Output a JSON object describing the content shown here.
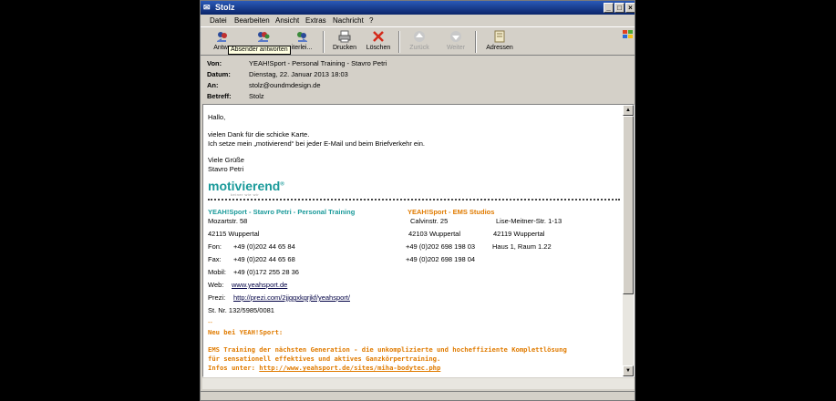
{
  "window": {
    "title": "Stolz"
  },
  "menu": [
    "Datei",
    "Bearbeiten",
    "Ansicht",
    "Extras",
    "Nachricht",
    "?"
  ],
  "toolbar": [
    {
      "label": "Antwo",
      "icon": "reply-icon",
      "disabled": false
    },
    {
      "label": "",
      "icon": "reply-all-icon",
      "disabled": false
    },
    {
      "label": "iterlei...",
      "icon": "forward-icon",
      "disabled": false
    },
    {
      "label": "Drucken",
      "icon": "print-icon",
      "disabled": false
    },
    {
      "label": "Löschen",
      "icon": "delete-icon",
      "disabled": false
    },
    {
      "label": "Zurück",
      "icon": "back-icon",
      "disabled": true
    },
    {
      "label": "Weiter",
      "icon": "next-icon",
      "disabled": true
    },
    {
      "label": "Adressen",
      "icon": "address-book-icon",
      "disabled": false
    }
  ],
  "tooltip": "Absender antworten",
  "headers": [
    {
      "key": "Von:",
      "value": "YEAH!Sport  -  Personal Training - Stavro Petri"
    },
    {
      "key": "Datum:",
      "value": "Dienstag, 22. Januar 2013 18:03"
    },
    {
      "key": "An:",
      "value": "stolz@oundmdesign.de"
    },
    {
      "key": "Betreff:",
      "value": "Stolz"
    }
  ],
  "message": {
    "greeting": "Hallo,",
    "line1": "vielen Dank für die schicke Karte.",
    "line2": "Ich setze mein „motivierend“ bei jeder E-Mail und beim Briefverkehr ein.",
    "closing": "Viele Grüße",
    "signature_name": "Stavro Petri",
    "logo": "motivierend",
    "logo_reg": "®",
    "logo_sub": "keiner wie wir",
    "left_title": "YEAH!Sport - Stavro Petri - Personal Training",
    "left_street": "Mozartstr. 58",
    "left_city": "42115 Wuppertal",
    "fon_label": "Fon:",
    "fon": "+49 (0)202 44 65 84",
    "fax_label": "Fax:",
    "fax": "+49 (0)202 44 65 68",
    "mobil_label": "Mobil:",
    "mobil": "+49 (0)172 255 28 36",
    "web_label": "Web:",
    "web": "www.yeahsport.de",
    "prezi_label": "Prezi:",
    "prezi": "http://prezi.com/2jjggxkgrjkf/yeahsport/",
    "stnr": "St. Nr. 132/5985/0081",
    "right_title": "YEAH!Sport - EMS Studios",
    "r_street1": "Calvinstr. 25",
    "r_street2": "Lise-Meitner-Str. 1-13",
    "r_city1": "42103 Wuppertal",
    "r_city2": "42119 Wuppertal",
    "r_phone1": "+49 (0)202 698 198 03",
    "r_phone1_extra": "Haus 1, Raum 1.22",
    "r_phone2": "+49 (0)202 698 198 04",
    "dashes": "--",
    "news_title": "Neu bei YEAH!Sport:",
    "news1": "EMS Training der nächsten Generation - die unkomplizierte und hocheffiziente Komplettlösung",
    "news2": "für sensationell effektives und aktives Ganzkörpertraining.",
    "news3_label": "Infos unter: ",
    "news3_link": "http://www.yeahsport.de/sites/miha-bodytec.php"
  }
}
